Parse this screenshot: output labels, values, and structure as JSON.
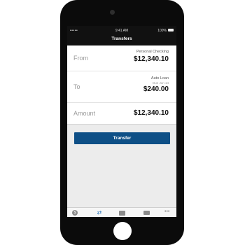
{
  "status_bar": {
    "signal": "•••••",
    "time": "9:41 AM",
    "battery": "100%"
  },
  "nav": {
    "title": "Transfers"
  },
  "form": {
    "from": {
      "label": "From",
      "account": "Personal Checking",
      "amount": "$12,340.10"
    },
    "to": {
      "label": "To",
      "account": "Auto Loan",
      "due": "Due Jun 14",
      "amount": "$240.00"
    },
    "amount": {
      "label": "Amount",
      "value": "$12,340.10"
    }
  },
  "transfer_button": {
    "label": "Transfer"
  },
  "tab_bar": {
    "items": [
      {
        "icon": "dollar-icon",
        "glyph": "$"
      },
      {
        "icon": "transfer-arrows-icon",
        "glyph": "⇄"
      },
      {
        "icon": "deposit-icon",
        "glyph": ""
      },
      {
        "icon": "card-icon",
        "glyph": ""
      },
      {
        "icon": "more-icon",
        "glyph": "•••"
      }
    ],
    "active_color": "#1e6fb8"
  },
  "colors": {
    "accent": "#0e4f86",
    "phone": "#0b0b0b"
  }
}
